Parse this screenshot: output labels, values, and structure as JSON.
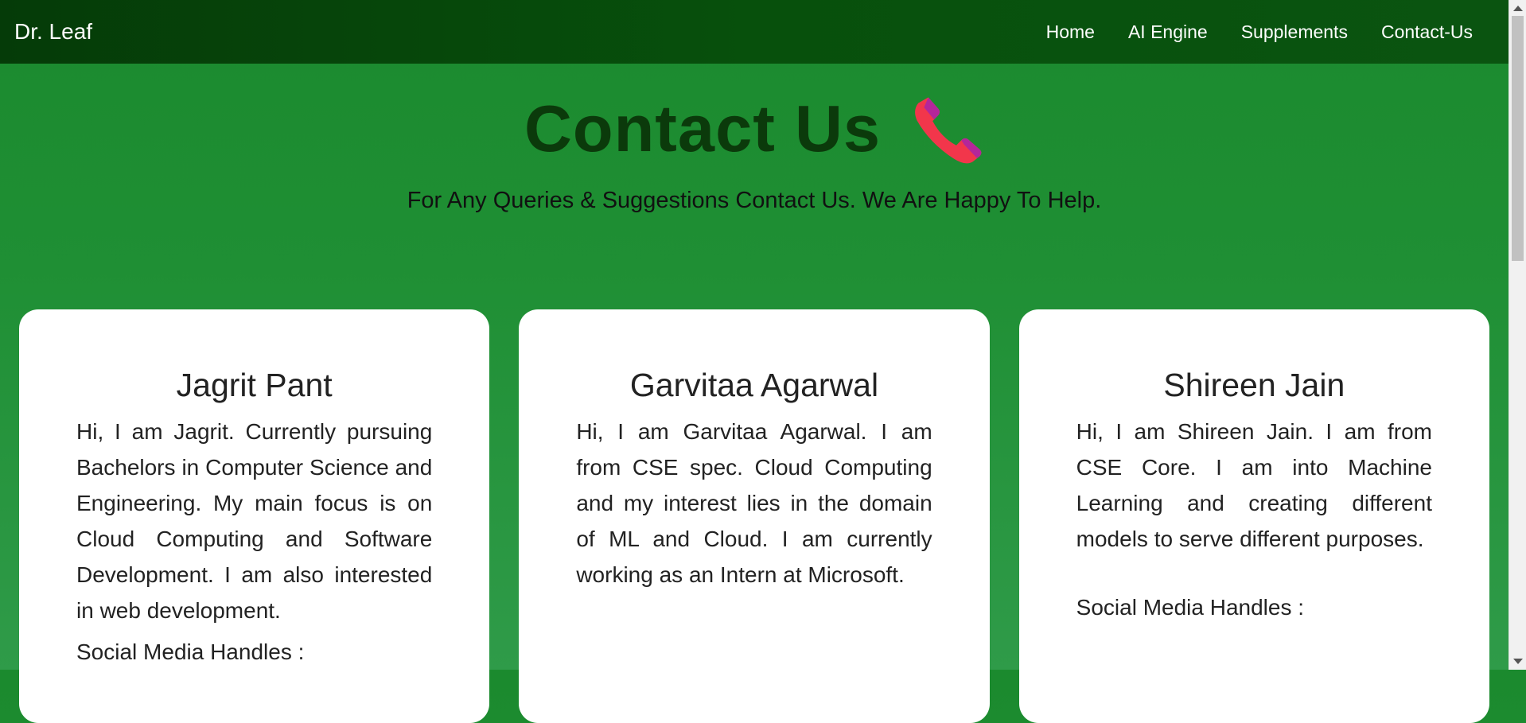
{
  "navbar": {
    "brand": "Dr. Leaf",
    "links": [
      "Home",
      "AI Engine",
      "Supplements",
      "Contact-Us"
    ]
  },
  "hero": {
    "title": "Contact Us",
    "icon": "phone-icon",
    "subtitle": "For Any Queries & Suggestions Contact Us. We Are Happy To Help."
  },
  "cards": [
    {
      "name": "Jagrit Pant",
      "bio": "Hi, I am Jagrit. Currently pursuing Bachelors in Computer Science and Engineering. My main focus is on Cloud Computing and Software Development. I am also interested in web development.",
      "social_label": "Social Media Handles :"
    },
    {
      "name": "Garvitaa Agarwal",
      "bio": "Hi, I am Garvitaa Agarwal. I am from CSE spec. Cloud Computing and my interest lies in the domain of ML and Cloud. I am currently working as an Intern at Microsoft.",
      "social_label": ""
    },
    {
      "name": "Shireen Jain",
      "bio": "Hi, I am Shireen Jain. I am from CSE Core. I am into Machine Learning and creating different models to serve different purposes.",
      "social_label": "Social Media Handles :"
    }
  ],
  "colors": {
    "navbar": "#07500c",
    "page_background": "#1f8f34",
    "title_text": "#0b3a0b",
    "phone_icon": "#f2364b",
    "phone_icon_accent": "#b4269a",
    "card_background": "#ffffff"
  }
}
